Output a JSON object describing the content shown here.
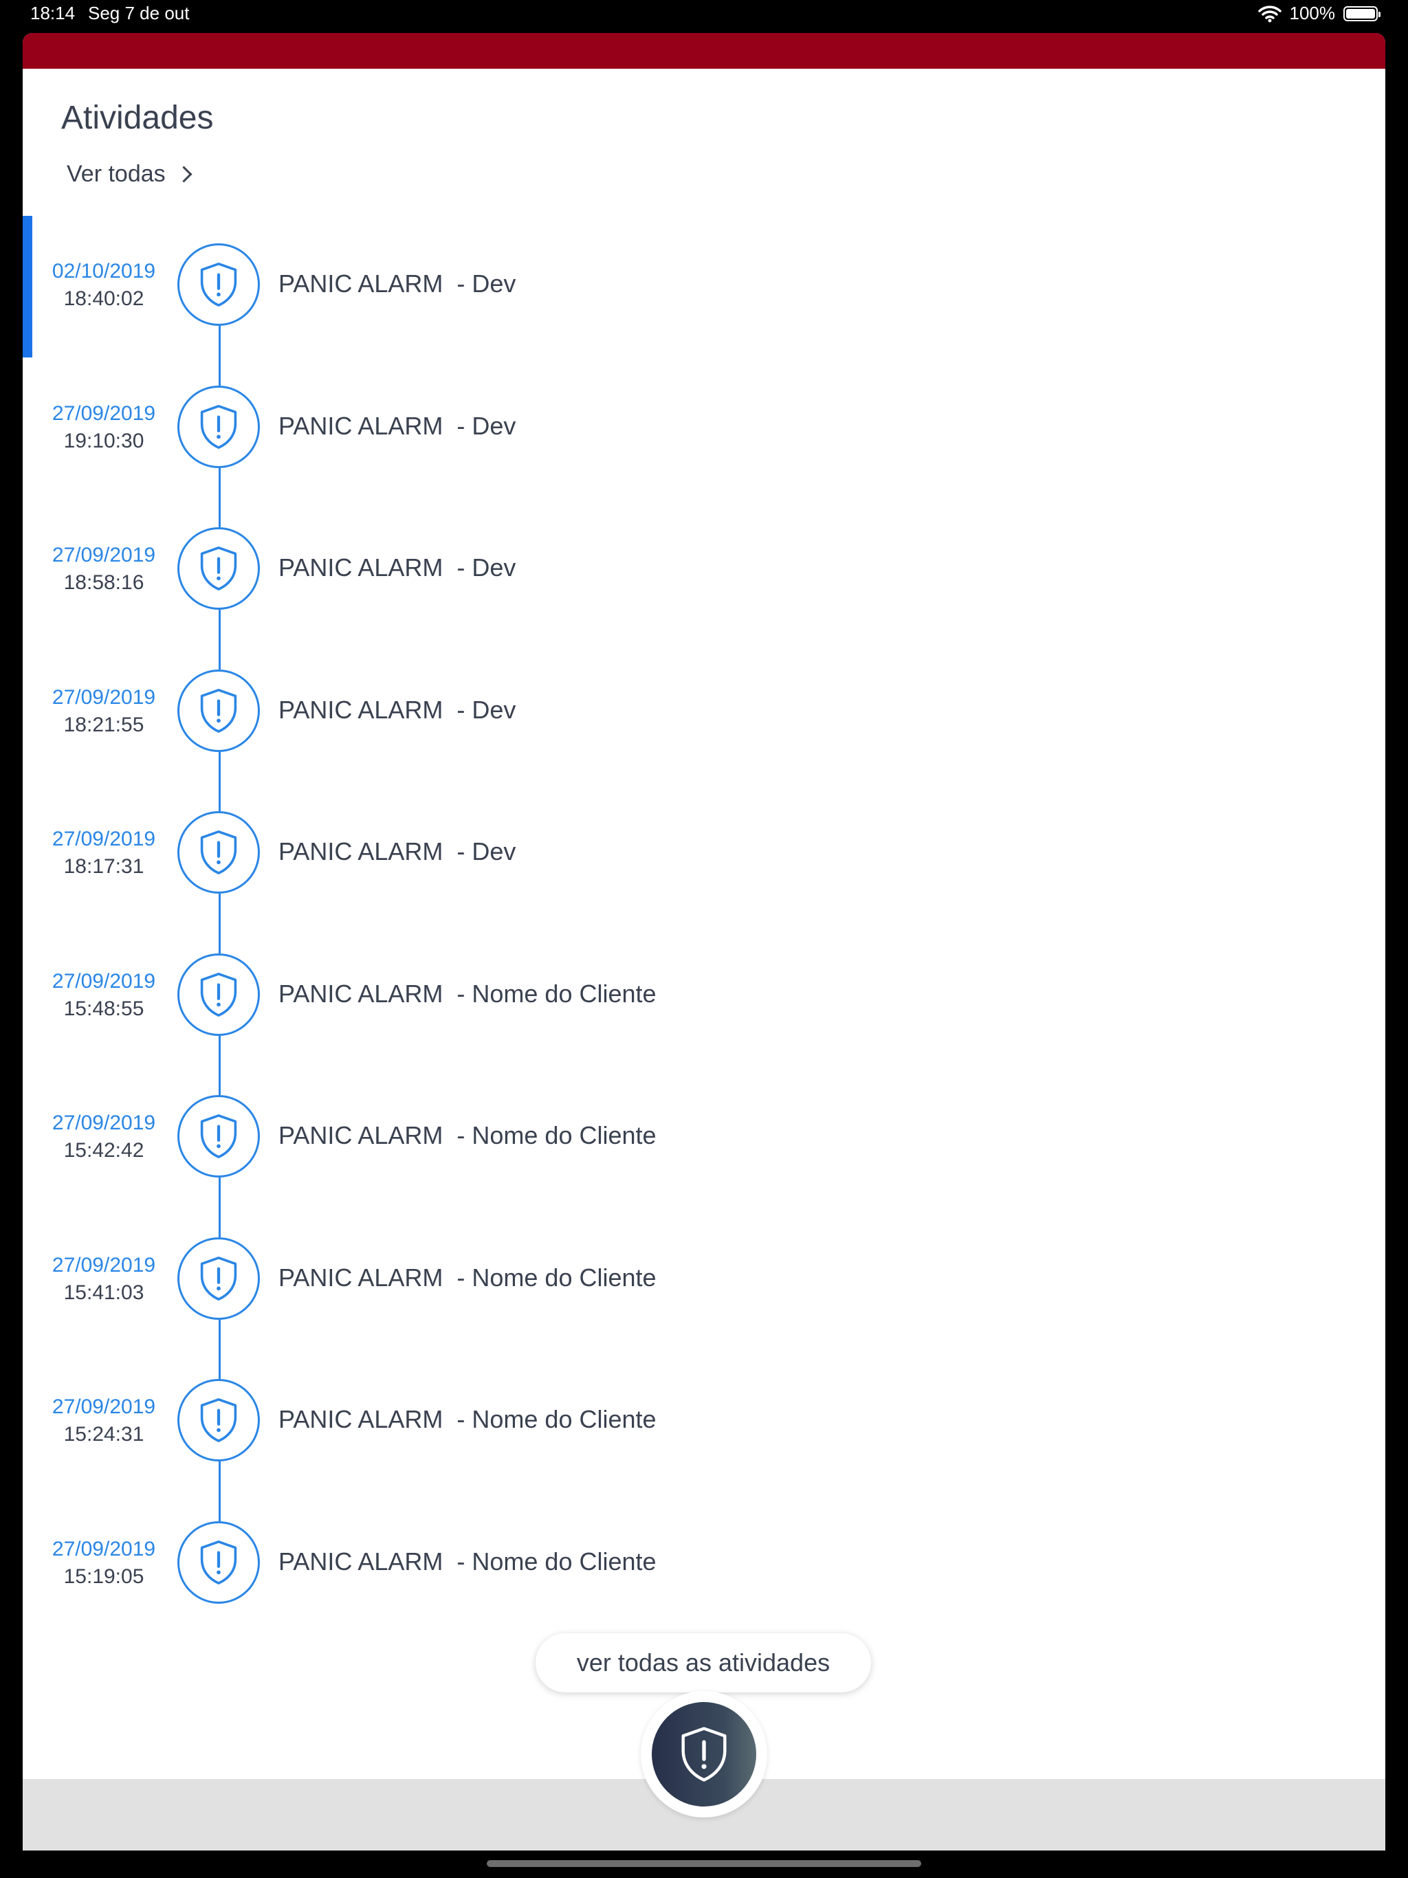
{
  "status_bar": {
    "time": "18:14",
    "date": "Seg 7 de out",
    "battery": "100%"
  },
  "colors": {
    "brand": "#970019",
    "accent": "#2a86e6",
    "text": "#3a4150"
  },
  "header": {
    "title": "Atividades",
    "see_all": "Ver todas"
  },
  "activities": [
    {
      "date": "02/10/2019",
      "time": "18:40:02",
      "label": "PANIC ALARM  - Dev",
      "selected": true
    },
    {
      "date": "27/09/2019",
      "time": "19:10:30",
      "label": "PANIC ALARM  - Dev"
    },
    {
      "date": "27/09/2019",
      "time": "18:58:16",
      "label": "PANIC ALARM  - Dev"
    },
    {
      "date": "27/09/2019",
      "time": "18:21:55",
      "label": "PANIC ALARM  - Dev"
    },
    {
      "date": "27/09/2019",
      "time": "18:17:31",
      "label": "PANIC ALARM  - Dev"
    },
    {
      "date": "27/09/2019",
      "time": "15:48:55",
      "label": "PANIC ALARM  - Nome do Cliente"
    },
    {
      "date": "27/09/2019",
      "time": "15:42:42",
      "label": "PANIC ALARM  - Nome do Cliente"
    },
    {
      "date": "27/09/2019",
      "time": "15:41:03",
      "label": "PANIC ALARM  - Nome do Cliente"
    },
    {
      "date": "27/09/2019",
      "time": "15:24:31",
      "label": "PANIC ALARM  - Nome do Cliente"
    },
    {
      "date": "27/09/2019",
      "time": "15:19:05",
      "label": "PANIC ALARM  - Nome do Cliente"
    }
  ],
  "footer": {
    "see_all_button": "ver todas as atividades"
  },
  "icons": {
    "activity_icon": "shield-alert-icon",
    "fab_icon": "shield-alert-icon"
  }
}
